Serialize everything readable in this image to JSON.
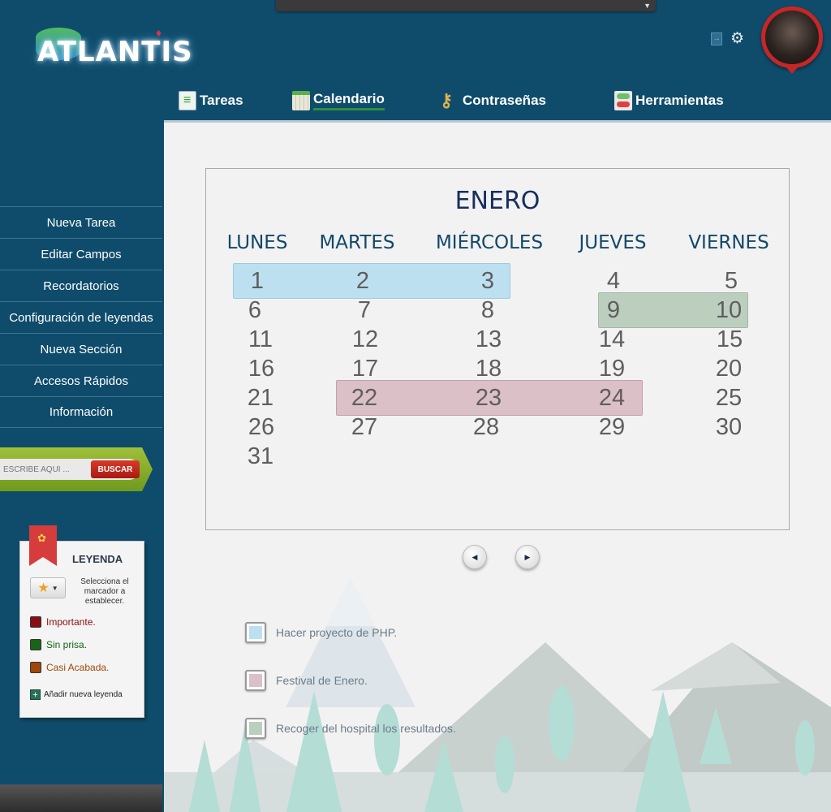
{
  "app": {
    "logo_text": "ATLANTIS"
  },
  "icons": {
    "logout": "logout-icon",
    "settings": "gear-icon",
    "avatar": "avatar"
  },
  "topnav": [
    {
      "label": "Tareas",
      "icon": "tasks-icon",
      "active": false
    },
    {
      "label": "Calendario",
      "icon": "calendar-icon",
      "active": true
    },
    {
      "label": "Contraseñas",
      "icon": "key-icon",
      "active": false
    },
    {
      "label": "Herramientas",
      "icon": "tools-icon",
      "active": false
    }
  ],
  "sidebar": {
    "items": [
      {
        "label": "Nueva Tarea"
      },
      {
        "label": "Editar Campos"
      },
      {
        "label": "Recordatorios"
      },
      {
        "label": "Configuración de leyendas"
      },
      {
        "label": "Nueva Sección"
      },
      {
        "label": "Accesos Rápidos"
      },
      {
        "label": "Información"
      }
    ]
  },
  "search": {
    "placeholder": "ESCRIBE AQUÍ ...",
    "button": "BUSCAR"
  },
  "legend": {
    "title": "LEYENDA",
    "marker_help": "Selecciona el marcador a establecer.",
    "items": [
      {
        "label": "Importante.",
        "color": "#8b0d12"
      },
      {
        "label": "Sin prisa.",
        "color": "#176515"
      },
      {
        "label": "Casi Acabada.",
        "color": "#a0460a"
      }
    ],
    "add_label": "Añadir nueva leyenda"
  },
  "calendar": {
    "month": "ENERO",
    "weekdays": [
      "LUNES",
      "MARTES",
      "MIÉRCOLES",
      "JUEVES",
      "VIERNES"
    ],
    "days": [
      [
        "1",
        "2",
        "3",
        "4",
        "5"
      ],
      [
        "6",
        "7",
        "8",
        "9",
        "10"
      ],
      [
        "11",
        "12",
        "13",
        "14",
        "15"
      ],
      [
        "16",
        "17",
        "18",
        "19",
        "20"
      ],
      [
        "21",
        "22",
        "23",
        "24",
        "25"
      ],
      [
        "26",
        "27",
        "28",
        "29",
        "30"
      ],
      [
        "31",
        "",
        "",
        "",
        ""
      ]
    ],
    "highlight_colors": {
      "blue": "#bde0f0",
      "green": "#bccfbf",
      "pink": "#dcc0c8"
    }
  },
  "events": [
    {
      "label": "Hacer proyecto de PHP.",
      "color": "#bde0f0"
    },
    {
      "label": "Festival de Enero.",
      "color": "#dcc0c8"
    },
    {
      "label": "Recoger del hospital los resultados.",
      "color": "#bccfbf"
    }
  ]
}
